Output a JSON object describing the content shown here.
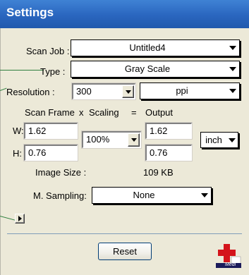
{
  "window": {
    "title": "Settings"
  },
  "scan_job": {
    "label": "Scan Job :",
    "value": "Untitled4"
  },
  "type": {
    "label": "Type :",
    "value": "Gray Scale"
  },
  "resolution": {
    "label": "Resolution :",
    "value": "300",
    "unit": "ppi"
  },
  "headers": {
    "scan_frame": "Scan Frame",
    "x": "x",
    "scaling": "Scaling",
    "eq": "=",
    "output": "Output"
  },
  "frame": {
    "w_label": "W:",
    "w_value": "1.62",
    "h_label": "H:",
    "h_value": "0.76"
  },
  "scaling": {
    "value": "100%"
  },
  "output": {
    "w_value": "1.62",
    "h_value": "0.76",
    "unit": "inch"
  },
  "image_size": {
    "label": "Image Size :",
    "value": "109 KB"
  },
  "m_sampling": {
    "label": "M. Sampling:",
    "value": "None"
  },
  "buttons": {
    "reset": "Reset"
  },
  "logo": {
    "text": "Medi"
  },
  "colors": {
    "titlebar": "#2a66bf",
    "panel": "#ece9d8",
    "leader": "#2f7f3f",
    "logo_red": "#d4141b"
  }
}
